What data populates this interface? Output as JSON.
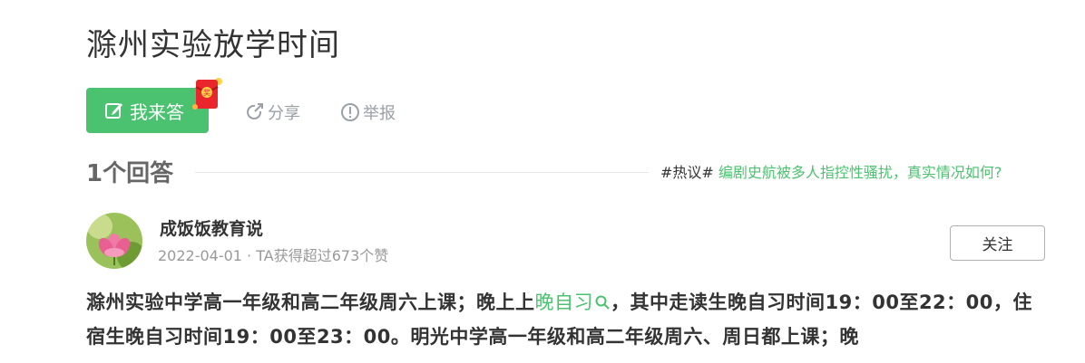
{
  "page": {
    "title": "滁州实验放学时间"
  },
  "actions": {
    "answer_label": "我来答",
    "redpack_label": "奖",
    "share_label": "分享",
    "report_label": "举报"
  },
  "answers": {
    "count_label": "1个回答"
  },
  "hot_topic": {
    "tag": "#热议#",
    "text": " 编剧史航被多人指控性骚扰，真实情况如何?"
  },
  "answer": {
    "author": "成饭饭教育说",
    "meta": "2022-04-01 · TA获得超过673个赞",
    "follow_label": "关注",
    "content_part1": "滁州实验中学高一年级和高二年级周六上课；晚上上",
    "content_link": "晚自习",
    "content_part2": "，其中走读生晚自习时间19：00至22：00，住宿生晚自习时间19：00至23：00。明光中学高一年级和高二年级周六、周日都上课；晚"
  },
  "colors": {
    "accent": "#4bc26f",
    "muted": "#9aa0a6"
  },
  "icons": {
    "answer": "edit-icon",
    "share": "share-icon",
    "report": "report-icon",
    "search": "search-icon"
  }
}
